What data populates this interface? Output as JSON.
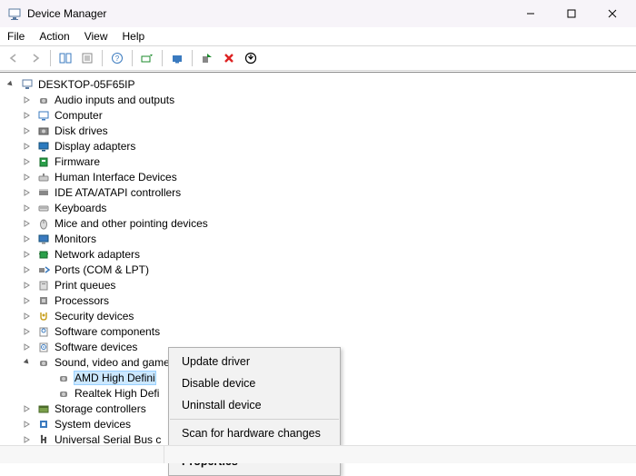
{
  "window": {
    "title": "Device Manager"
  },
  "menu": {
    "file": "File",
    "action": "Action",
    "view": "View",
    "help": "Help"
  },
  "tree": {
    "root": "DESKTOP-05F65IP",
    "categories": [
      "Audio inputs and outputs",
      "Computer",
      "Disk drives",
      "Display adapters",
      "Firmware",
      "Human Interface Devices",
      "IDE ATA/ATAPI controllers",
      "Keyboards",
      "Mice and other pointing devices",
      "Monitors",
      "Network adapters",
      "Ports (COM & LPT)",
      "Print queues",
      "Processors",
      "Security devices",
      "Software components",
      "Software devices",
      "Sound, video and game controllers",
      "Storage controllers",
      "System devices",
      "Universal Serial Bus c"
    ],
    "sound_children": {
      "amd": "AMD High Defini",
      "realtek": "Realtek High Defi"
    }
  },
  "contextmenu": {
    "update": "Update driver",
    "disable": "Disable device",
    "uninstall": "Uninstall device",
    "scan": "Scan for hardware changes",
    "properties": "Properties"
  }
}
